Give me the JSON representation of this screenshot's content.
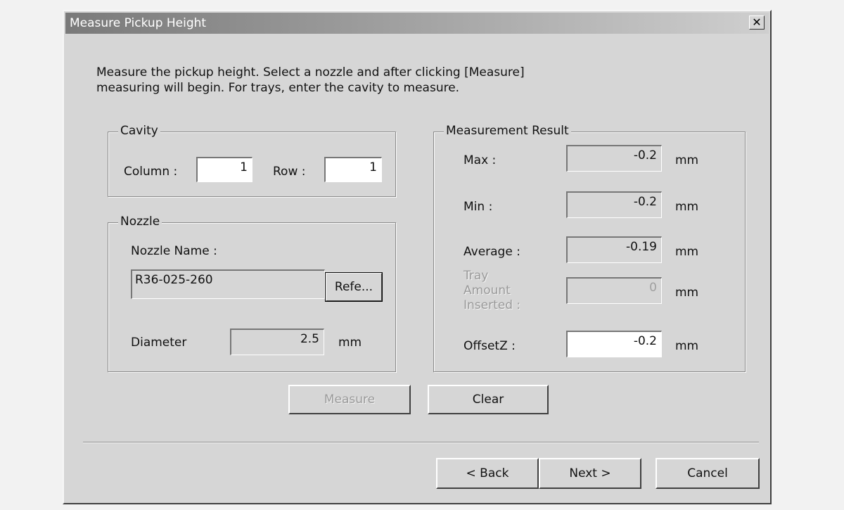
{
  "window": {
    "title": "Measure Pickup Height"
  },
  "instructions": [
    "Measure the pickup height. Select a nozzle and after clicking [Measure]",
    "measuring will begin. For trays, enter the cavity to measure."
  ],
  "cavity": {
    "group_label": "Cavity",
    "column_label": "Column :",
    "column_value": "1",
    "row_label": "Row :",
    "row_value": "1"
  },
  "nozzle": {
    "group_label": "Nozzle",
    "name_label": "Nozzle Name :",
    "name_value": "R36-025-260",
    "reference_button": "Refe...",
    "diameter_label": "Diameter",
    "diameter_value": "2.5",
    "diameter_unit": "mm"
  },
  "result": {
    "group_label": "Measurement Result",
    "max_label": "Max :",
    "max_value": "-0.2",
    "min_label": "Min :",
    "min_value": "-0.2",
    "avg_label": "Average :",
    "avg_value": "-0.19",
    "tray_label_1": "Tray",
    "tray_label_2": "Amount",
    "tray_label_3": "Inserted :",
    "tray_value": "0",
    "offset_label": "OffsetZ :",
    "offset_value": "-0.2",
    "unit": "mm"
  },
  "actions": {
    "measure": "Measure",
    "clear": "Clear"
  },
  "footer": {
    "back": "< Back",
    "next": "Next >",
    "cancel": "Cancel"
  },
  "colors": {
    "titlebar_start": "#7a7a7a",
    "dialog_bg": "#d6d6d6"
  }
}
